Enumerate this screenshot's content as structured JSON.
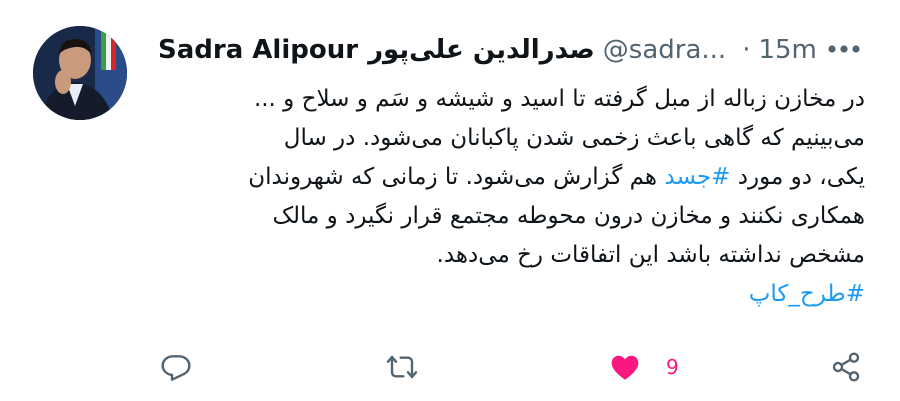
{
  "tweet": {
    "author_name": "Sadra Alipour",
    "author_name_fa": "صدرالدین علی‌پور",
    "handle": "@sadra...",
    "separator": "·",
    "time": "15m",
    "lines": [
      {
        "text": "در مخازن زباله از مبل گرفته تا اسید و شیشه و سَم و سلاح و ..."
      },
      {
        "text": "می‌بینیم که گاهی باعث زخمی شدن پاکبانان می‌شود. در سال"
      },
      {
        "pre": "یکی، دو مورد ",
        "tag": "#جسد",
        "post": " هم گزارش می‌شود. تا زمانی که شهروندان"
      },
      {
        "text": "همکاری نکنند و مخازن درون محوطه مجتمع قرار نگیرد و مالک"
      },
      {
        "text": "مشخص نداشته باشد این اتفاقات رخ می‌دهد."
      }
    ],
    "hashtag_line": "#طرح_کاپ"
  },
  "actions": {
    "like_count": "9"
  },
  "colors": {
    "text": "#0f1419",
    "secondary": "#536471",
    "link": "#1d9bf0",
    "like": "#f91880"
  },
  "icons": {
    "more": "more-horizontal-icon",
    "reply": "reply-icon",
    "retweet": "retweet-icon",
    "like": "heart-filled-icon",
    "share": "share-icon"
  }
}
